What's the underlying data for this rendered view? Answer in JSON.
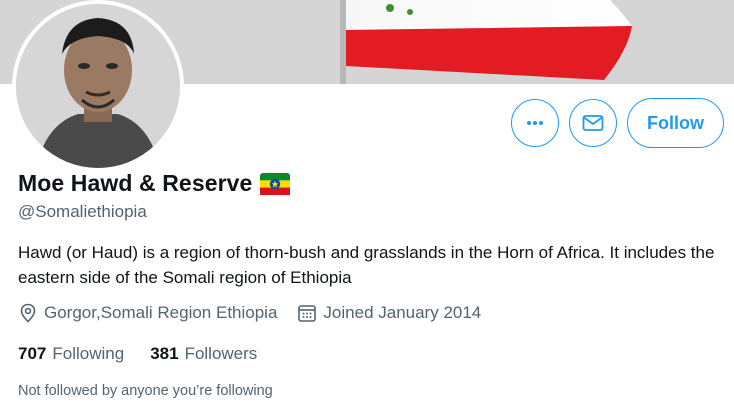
{
  "profile": {
    "display_name": "Moe Hawd & Reserve",
    "handle": "@Somaliethiopia",
    "bio": "Hawd (or Haud) is a region of thorn-bush and grasslands in the Horn of Africa. It includes the eastern side of the Somali region of Ethiopia",
    "location": "Gorgor,Somali Region Ethiopia",
    "joined": "Joined January 2014"
  },
  "stats": {
    "following_count": "707",
    "following_label": "Following",
    "followers_count": "381",
    "followers_label": "Followers"
  },
  "actions": {
    "follow_label": "Follow",
    "more_icon": "more-icon",
    "message_icon": "mail-icon"
  },
  "footnote": "Not followed by anyone you’re following",
  "colors": {
    "accent": "#1d9bf0",
    "secondary_text": "#536471",
    "primary_text": "#0f1419"
  }
}
